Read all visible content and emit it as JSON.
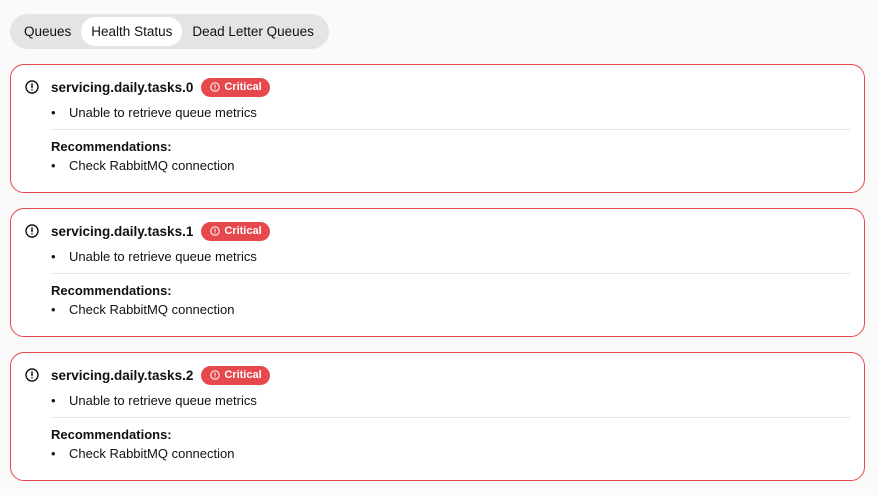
{
  "tabs": [
    {
      "label": "Queues"
    },
    {
      "label": "Health Status"
    },
    {
      "label": "Dead Letter Queues"
    }
  ],
  "active_tab": "Health Status",
  "accent_color": "#e5484d",
  "cards": [
    {
      "name": "servicing.daily.tasks.0",
      "badge": "Critical",
      "issues": [
        "Unable to retrieve queue metrics"
      ],
      "recommendations_title": "Recommendations:",
      "recommendations": [
        "Check RabbitMQ connection"
      ]
    },
    {
      "name": "servicing.daily.tasks.1",
      "badge": "Critical",
      "issues": [
        "Unable to retrieve queue metrics"
      ],
      "recommendations_title": "Recommendations:",
      "recommendations": [
        "Check RabbitMQ connection"
      ]
    },
    {
      "name": "servicing.daily.tasks.2",
      "badge": "Critical",
      "issues": [
        "Unable to retrieve queue metrics"
      ],
      "recommendations_title": "Recommendations:",
      "recommendations": [
        "Check RabbitMQ connection"
      ]
    }
  ]
}
